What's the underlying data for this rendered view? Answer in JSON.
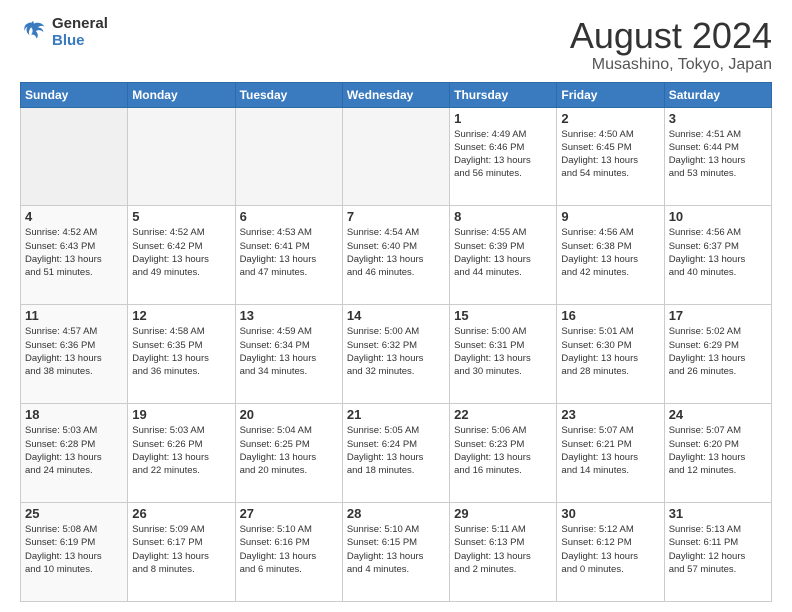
{
  "header": {
    "logo_general": "General",
    "logo_blue": "Blue",
    "title": "August 2024",
    "subtitle": "Musashino, Tokyo, Japan"
  },
  "days_of_week": [
    "Sunday",
    "Monday",
    "Tuesday",
    "Wednesday",
    "Thursday",
    "Friday",
    "Saturday"
  ],
  "weeks": [
    [
      {
        "day": "",
        "info": ""
      },
      {
        "day": "",
        "info": ""
      },
      {
        "day": "",
        "info": ""
      },
      {
        "day": "",
        "info": ""
      },
      {
        "day": "1",
        "info": "Sunrise: 4:49 AM\nSunset: 6:46 PM\nDaylight: 13 hours\nand 56 minutes."
      },
      {
        "day": "2",
        "info": "Sunrise: 4:50 AM\nSunset: 6:45 PM\nDaylight: 13 hours\nand 54 minutes."
      },
      {
        "day": "3",
        "info": "Sunrise: 4:51 AM\nSunset: 6:44 PM\nDaylight: 13 hours\nand 53 minutes."
      }
    ],
    [
      {
        "day": "4",
        "info": "Sunrise: 4:52 AM\nSunset: 6:43 PM\nDaylight: 13 hours\nand 51 minutes."
      },
      {
        "day": "5",
        "info": "Sunrise: 4:52 AM\nSunset: 6:42 PM\nDaylight: 13 hours\nand 49 minutes."
      },
      {
        "day": "6",
        "info": "Sunrise: 4:53 AM\nSunset: 6:41 PM\nDaylight: 13 hours\nand 47 minutes."
      },
      {
        "day": "7",
        "info": "Sunrise: 4:54 AM\nSunset: 6:40 PM\nDaylight: 13 hours\nand 46 minutes."
      },
      {
        "day": "8",
        "info": "Sunrise: 4:55 AM\nSunset: 6:39 PM\nDaylight: 13 hours\nand 44 minutes."
      },
      {
        "day": "9",
        "info": "Sunrise: 4:56 AM\nSunset: 6:38 PM\nDaylight: 13 hours\nand 42 minutes."
      },
      {
        "day": "10",
        "info": "Sunrise: 4:56 AM\nSunset: 6:37 PM\nDaylight: 13 hours\nand 40 minutes."
      }
    ],
    [
      {
        "day": "11",
        "info": "Sunrise: 4:57 AM\nSunset: 6:36 PM\nDaylight: 13 hours\nand 38 minutes."
      },
      {
        "day": "12",
        "info": "Sunrise: 4:58 AM\nSunset: 6:35 PM\nDaylight: 13 hours\nand 36 minutes."
      },
      {
        "day": "13",
        "info": "Sunrise: 4:59 AM\nSunset: 6:34 PM\nDaylight: 13 hours\nand 34 minutes."
      },
      {
        "day": "14",
        "info": "Sunrise: 5:00 AM\nSunset: 6:32 PM\nDaylight: 13 hours\nand 32 minutes."
      },
      {
        "day": "15",
        "info": "Sunrise: 5:00 AM\nSunset: 6:31 PM\nDaylight: 13 hours\nand 30 minutes."
      },
      {
        "day": "16",
        "info": "Sunrise: 5:01 AM\nSunset: 6:30 PM\nDaylight: 13 hours\nand 28 minutes."
      },
      {
        "day": "17",
        "info": "Sunrise: 5:02 AM\nSunset: 6:29 PM\nDaylight: 13 hours\nand 26 minutes."
      }
    ],
    [
      {
        "day": "18",
        "info": "Sunrise: 5:03 AM\nSunset: 6:28 PM\nDaylight: 13 hours\nand 24 minutes."
      },
      {
        "day": "19",
        "info": "Sunrise: 5:03 AM\nSunset: 6:26 PM\nDaylight: 13 hours\nand 22 minutes."
      },
      {
        "day": "20",
        "info": "Sunrise: 5:04 AM\nSunset: 6:25 PM\nDaylight: 13 hours\nand 20 minutes."
      },
      {
        "day": "21",
        "info": "Sunrise: 5:05 AM\nSunset: 6:24 PM\nDaylight: 13 hours\nand 18 minutes."
      },
      {
        "day": "22",
        "info": "Sunrise: 5:06 AM\nSunset: 6:23 PM\nDaylight: 13 hours\nand 16 minutes."
      },
      {
        "day": "23",
        "info": "Sunrise: 5:07 AM\nSunset: 6:21 PM\nDaylight: 13 hours\nand 14 minutes."
      },
      {
        "day": "24",
        "info": "Sunrise: 5:07 AM\nSunset: 6:20 PM\nDaylight: 13 hours\nand 12 minutes."
      }
    ],
    [
      {
        "day": "25",
        "info": "Sunrise: 5:08 AM\nSunset: 6:19 PM\nDaylight: 13 hours\nand 10 minutes."
      },
      {
        "day": "26",
        "info": "Sunrise: 5:09 AM\nSunset: 6:17 PM\nDaylight: 13 hours\nand 8 minutes."
      },
      {
        "day": "27",
        "info": "Sunrise: 5:10 AM\nSunset: 6:16 PM\nDaylight: 13 hours\nand 6 minutes."
      },
      {
        "day": "28",
        "info": "Sunrise: 5:10 AM\nSunset: 6:15 PM\nDaylight: 13 hours\nand 4 minutes."
      },
      {
        "day": "29",
        "info": "Sunrise: 5:11 AM\nSunset: 6:13 PM\nDaylight: 13 hours\nand 2 minutes."
      },
      {
        "day": "30",
        "info": "Sunrise: 5:12 AM\nSunset: 6:12 PM\nDaylight: 13 hours\nand 0 minutes."
      },
      {
        "day": "31",
        "info": "Sunrise: 5:13 AM\nSunset: 6:11 PM\nDaylight: 12 hours\nand 57 minutes."
      }
    ]
  ]
}
